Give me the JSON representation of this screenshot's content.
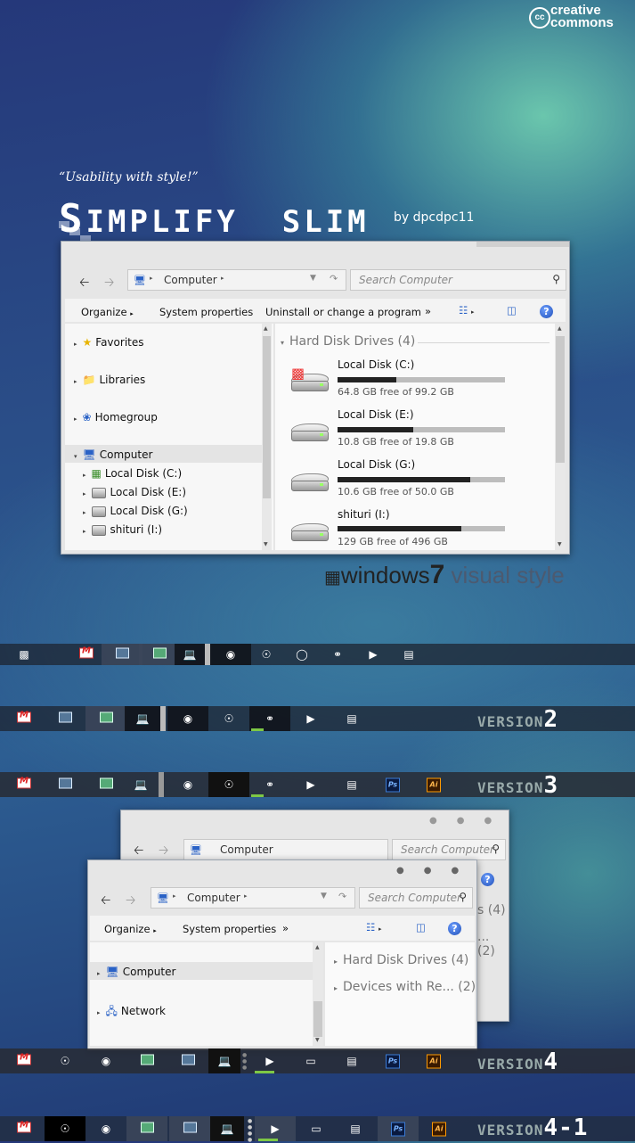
{
  "cc": {
    "line1": "creative",
    "line2": "commons",
    "badge": "cc"
  },
  "tagline": "“Usability with style!”",
  "brand": {
    "word1_first": "S",
    "word1_rest": "IMPLIFY",
    "word2": "SLIM",
    "by": "by dpcdpc11"
  },
  "w1": {
    "address": "Computer",
    "search_placeholder": "Search Computer",
    "commands": [
      "Organize",
      "System properties",
      "Uninstall or change a program",
      "»"
    ],
    "nav": [
      "Favorites",
      "Libraries",
      "Homegroup",
      "Computer",
      "Local Disk (C:)",
      "Local Disk (E:)",
      "Local Disk (G:)",
      "shituri (I:)"
    ],
    "group": "Hard Disk Drives (4)",
    "disks": [
      {
        "name": "Local Disk (C:)",
        "free": "64.8 GB free of 99.2 GB",
        "used_fraction": 0.35
      },
      {
        "name": "Local Disk (E:)",
        "free": "10.8 GB free of 19.8 GB",
        "used_fraction": 0.45
      },
      {
        "name": "Local Disk (G:)",
        "free": "10.6 GB free of 50.0 GB",
        "used_fraction": 0.79
      },
      {
        "name": "shituri (I:)",
        "free": "129 GB free of 496 GB",
        "used_fraction": 0.74
      }
    ]
  },
  "w7": {
    "brand": "windows",
    "num": "7",
    "rest": " visual style"
  },
  "versions": {
    "v2": "VERSION",
    "v2n": "2",
    "v3": "VERSION",
    "v3n": "3",
    "v4": "VERSION",
    "v4n": "4",
    "v41": "VERSION",
    "v41n": "4-1"
  },
  "w2back": {
    "address": "Computer",
    "search_placeholder": "Search Computer",
    "group1": "s (4)",
    "group2": "... (2)"
  },
  "w2": {
    "address": "Computer",
    "search_placeholder": "Search Computer",
    "commands": [
      "Organize",
      "System properties",
      "»"
    ],
    "nav": [
      "Computer",
      "Network"
    ],
    "groups": [
      "Hard Disk Drives (4)",
      "Devices with Re... (2)"
    ]
  },
  "icons": {
    "help": "?",
    "ps": "Ps",
    "ai": "Ai"
  }
}
